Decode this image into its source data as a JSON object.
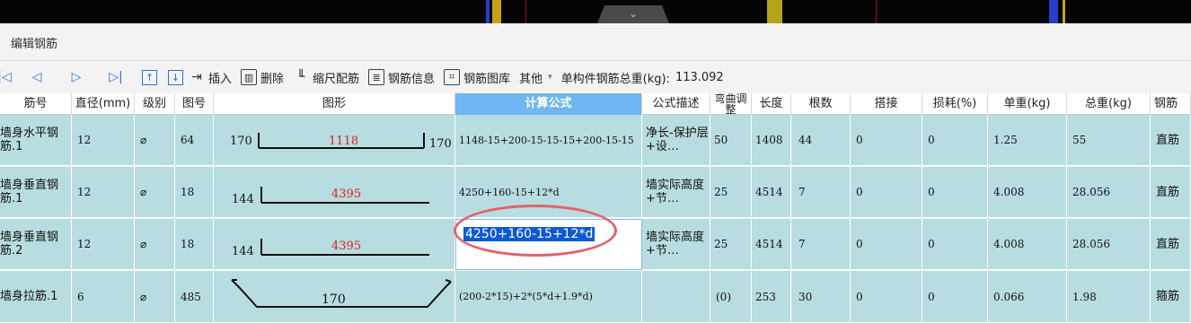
{
  "panel": {
    "title": "编辑钢筋"
  },
  "toolbar": {
    "insert": "插入",
    "delete": "删除",
    "scale": "缩尺配筋",
    "info": "钢筋信息",
    "library": "钢筋图库",
    "other": "其他",
    "total_label": "单构件钢筋总重(kg):",
    "total_value": "113.092"
  },
  "columns": [
    "筋号",
    "直径(mm)",
    "级别",
    "图号",
    "图形",
    "计算公式",
    "公式描述",
    "弯曲调整",
    "长度",
    "根数",
    "搭接",
    "损耗(%)",
    "单重(kg)",
    "总重(kg)",
    "钢筋"
  ],
  "rows": [
    {
      "name": "墙身水平钢筋.1",
      "dia": "12",
      "grade": "⌀",
      "fig": "64",
      "shape_left": "170",
      "shape_mid": "1118",
      "shape_right": "170",
      "formula": "1148-15+200-15-15-15+200-15-15",
      "desc": "净长-保护层+设…",
      "bend": "50",
      "len": "1408",
      "cnt": "44",
      "lap": "0",
      "loss": "0",
      "unit": "1.25",
      "total": "55",
      "type": "直筋"
    },
    {
      "name": "墙身垂直钢筋.1",
      "dia": "12",
      "grade": "⌀",
      "fig": "18",
      "shape_left": "144",
      "shape_mid": "4395",
      "formula": "4250+160-15+12*d",
      "desc": "墙实际高度+节…",
      "bend": "25",
      "len": "4514",
      "cnt": "7",
      "lap": "0",
      "loss": "0",
      "unit": "4.008",
      "total": "28.056",
      "type": "直筋"
    },
    {
      "name": "墙身垂直钢筋.2",
      "dia": "12",
      "grade": "⌀",
      "fig": "18",
      "shape_left": "144",
      "shape_mid": "4395",
      "formula": "4250+160-15+12*d",
      "desc": "墙实际高度+节…",
      "bend": "25",
      "len": "4514",
      "cnt": "7",
      "lap": "0",
      "loss": "0",
      "unit": "4.008",
      "total": "28.056",
      "type": "直筋"
    },
    {
      "name": "墙身拉筋.1",
      "dia": "6",
      "grade": "⌀",
      "fig": "485",
      "shape_mid": "170",
      "formula": "(200-2*15)+2*(5*d+1.9*d)",
      "desc": "",
      "bend": "(0)",
      "len": "253",
      "cnt": "30",
      "lap": "0",
      "loss": "0",
      "unit": "0.066",
      "total": "1.98",
      "type": "箍筋"
    }
  ],
  "colors": {
    "row_bg": "#b7dde0",
    "header_active": "#6fb6f2",
    "dim_red": "#e02020",
    "highlight": "#e2626b"
  }
}
